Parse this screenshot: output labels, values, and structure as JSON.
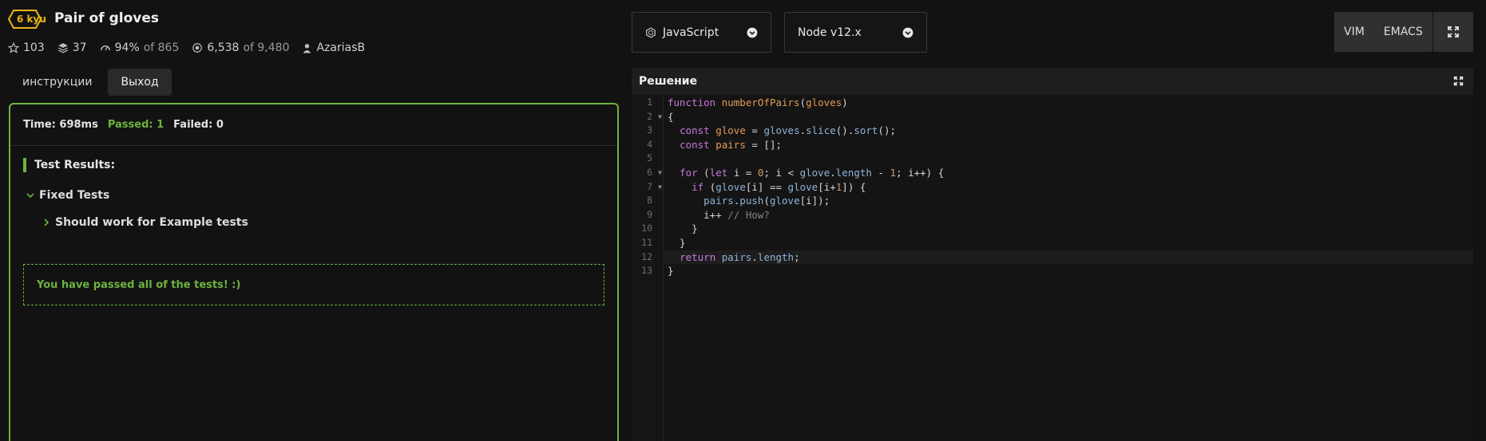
{
  "kata": {
    "rank": "6 kyu",
    "title": "Pair of gloves",
    "stats": {
      "stars": "103",
      "collections": "37",
      "satisfaction": "94%",
      "satisfaction_of": "of 865",
      "completed": "6,538",
      "completed_of": "of 9,480",
      "author": "AzariasB"
    }
  },
  "tabs": [
    {
      "label": "инструкции",
      "active": false
    },
    {
      "label": "Выход",
      "active": true
    }
  ],
  "output": {
    "time": "Time: 698ms",
    "passed": "Passed: 1",
    "failed": "Failed: 0",
    "test_results_label": "Test Results:",
    "group_label": "Fixed Tests",
    "test_label": "Should work for Example tests",
    "pass_message": "You have passed all of the tests! :)"
  },
  "selectors": {
    "language": "JavaScript",
    "runtime": "Node v12.x"
  },
  "modes": [
    "VIM",
    "EMACS"
  ],
  "editor": {
    "title": "Решение",
    "active_line": 12,
    "fold_lines": [
      2,
      6,
      7
    ],
    "lines": [
      [
        {
          "t": "kw",
          "v": "function "
        },
        {
          "t": "fn",
          "v": "numberOfPairs"
        },
        {
          "t": "pl",
          "v": "("
        },
        {
          "t": "var",
          "v": "gloves"
        },
        {
          "t": "pl",
          "v": ")"
        }
      ],
      [
        {
          "t": "pl",
          "v": "{"
        }
      ],
      [
        {
          "t": "pl",
          "v": "  "
        },
        {
          "t": "kw",
          "v": "const "
        },
        {
          "t": "var",
          "v": "glove"
        },
        {
          "t": "pl",
          "v": " = "
        },
        {
          "t": "prop",
          "v": "gloves"
        },
        {
          "t": "pl",
          "v": "."
        },
        {
          "t": "prop",
          "v": "slice"
        },
        {
          "t": "pl",
          "v": "()."
        },
        {
          "t": "prop",
          "v": "sort"
        },
        {
          "t": "pl",
          "v": "();"
        }
      ],
      [
        {
          "t": "pl",
          "v": "  "
        },
        {
          "t": "kw",
          "v": "const "
        },
        {
          "t": "var",
          "v": "pairs"
        },
        {
          "t": "pl",
          "v": " = [];"
        }
      ],
      [
        {
          "t": "pl",
          "v": ""
        }
      ],
      [
        {
          "t": "pl",
          "v": "  "
        },
        {
          "t": "kw",
          "v": "for "
        },
        {
          "t": "pl",
          "v": "("
        },
        {
          "t": "kw",
          "v": "let "
        },
        {
          "t": "pl",
          "v": "i = "
        },
        {
          "t": "num",
          "v": "0"
        },
        {
          "t": "pl",
          "v": "; i < "
        },
        {
          "t": "prop",
          "v": "glove"
        },
        {
          "t": "pl",
          "v": "."
        },
        {
          "t": "prop",
          "v": "length"
        },
        {
          "t": "pl",
          "v": " - "
        },
        {
          "t": "num",
          "v": "1"
        },
        {
          "t": "pl",
          "v": "; i++) {"
        }
      ],
      [
        {
          "t": "pl",
          "v": "    "
        },
        {
          "t": "kw",
          "v": "if "
        },
        {
          "t": "pl",
          "v": "("
        },
        {
          "t": "prop",
          "v": "glove"
        },
        {
          "t": "pl",
          "v": "[i] == "
        },
        {
          "t": "prop",
          "v": "glove"
        },
        {
          "t": "pl",
          "v": "[i+"
        },
        {
          "t": "num",
          "v": "1"
        },
        {
          "t": "pl",
          "v": "]) {"
        }
      ],
      [
        {
          "t": "pl",
          "v": "      "
        },
        {
          "t": "prop",
          "v": "pairs"
        },
        {
          "t": "pl",
          "v": "."
        },
        {
          "t": "prop",
          "v": "push"
        },
        {
          "t": "pl",
          "v": "("
        },
        {
          "t": "prop",
          "v": "glove"
        },
        {
          "t": "pl",
          "v": "[i]);"
        }
      ],
      [
        {
          "t": "pl",
          "v": "      i++ "
        },
        {
          "t": "cm",
          "v": "// How?"
        }
      ],
      [
        {
          "t": "pl",
          "v": "    }"
        }
      ],
      [
        {
          "t": "pl",
          "v": "  }"
        }
      ],
      [
        {
          "t": "pl",
          "v": "  "
        },
        {
          "t": "kw",
          "v": "return "
        },
        {
          "t": "prop",
          "v": "pairs"
        },
        {
          "t": "pl",
          "v": "."
        },
        {
          "t": "prop",
          "v": "length"
        },
        {
          "t": "pl",
          "v": ";"
        }
      ],
      [
        {
          "t": "pl",
          "v": "}"
        }
      ]
    ]
  }
}
